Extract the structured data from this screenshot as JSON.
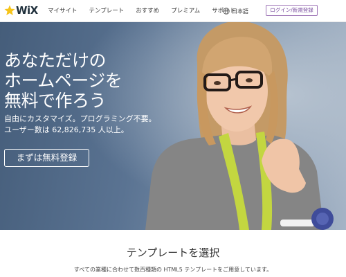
{
  "header": {
    "logo_text": "WiX",
    "nav": [
      {
        "label": "マイサイト"
      },
      {
        "label": "テンプレート"
      },
      {
        "label": "おすすめ"
      },
      {
        "label": "プレミアム"
      },
      {
        "label": "サポート"
      }
    ],
    "language": "日本語",
    "login_button": "ログイン/新規登録"
  },
  "hero": {
    "headline": [
      "あなただけの",
      "ホームページを",
      "無料で作ろう"
    ],
    "subline": [
      "自由にカスタマイズ。プログラミング不要。",
      "ユーザー数は 62,826,735 人以上。"
    ],
    "cta": "まずは無料登録"
  },
  "section": {
    "title": "テンプレートを選択",
    "description": "すべての業種に合わせて数百種類の HTML5 テンプレートをご用意しています。"
  },
  "colors": {
    "accent": "#7b4fa0",
    "logo_yellow": "#f6c41a",
    "hero_bg": "#5a7392",
    "text_dark": "#333333"
  },
  "icons": {
    "logo": "wix-star-logo-icon",
    "language": "globe-icon"
  }
}
